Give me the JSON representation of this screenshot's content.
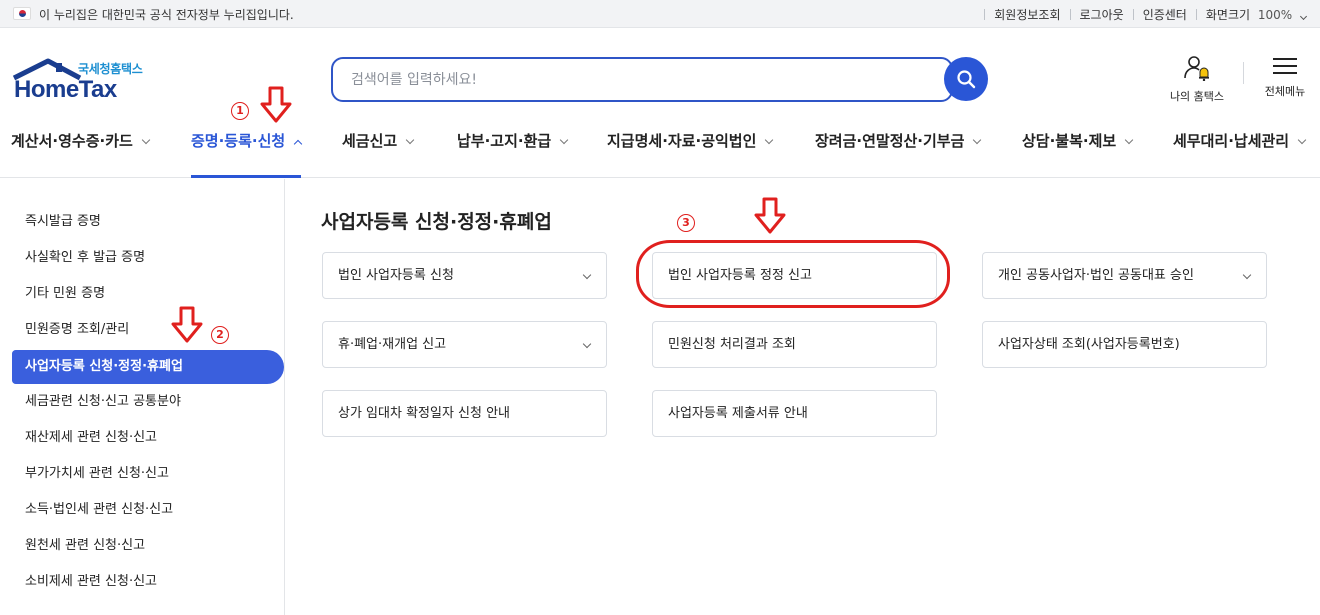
{
  "topbar": {
    "notice": "이 누리집은 대한민국 공식 전자정부 누리집입니다.",
    "links": [
      "회원정보조회",
      "로그아웃",
      "인증센터"
    ],
    "zoom_label": "화면크기",
    "zoom_value": "100%"
  },
  "logo": {
    "sub": "국세청홈택스",
    "main": "HomeTax"
  },
  "search": {
    "placeholder": "검색어를 입력하세요!"
  },
  "header": {
    "my_home": "나의 홈택스",
    "all_menu": "전체메뉴"
  },
  "nav": {
    "items": [
      "계산서·영수증·카드",
      "증명·등록·신청",
      "세금신고",
      "납부·고지·환급",
      "지급명세·자료·공익법인",
      "장려금·연말정산·기부금",
      "상담·불복·제보",
      "세무대리·납세관리"
    ],
    "active_index": 1
  },
  "sidebar": {
    "items": [
      "즉시발급 증명",
      "사실확인 후 발급 증명",
      "기타 민원 증명",
      "민원증명 조회/관리",
      "사업자등록 신청·정정·휴폐업",
      "세금관련 신청·신고 공통분야",
      "재산제세 관련 신청·신고",
      "부가가치세 관련 신청·신고",
      "소득·법인세 관련 신청·신고",
      "원천세 관련 신청·신고",
      "소비제세 관련 신청·신고"
    ],
    "active_index": 4
  },
  "main": {
    "title": "사업자등록 신청·정정·휴폐업",
    "cards": [
      {
        "label": "법인 사업자등록 신청",
        "expandable": true
      },
      {
        "label": "법인 사업자등록 정정 신고",
        "expandable": false
      },
      {
        "label": "개인 공동사업자·법인 공동대표 승인",
        "expandable": true
      },
      {
        "label": "휴·폐업·재개업 신고",
        "expandable": true
      },
      {
        "label": "민원신청 처리결과 조회",
        "expandable": false
      },
      {
        "label": "사업자상태 조회(사업자등록번호)",
        "expandable": false
      },
      {
        "label": "상가 임대차 확정일자 신청 안내",
        "expandable": false
      },
      {
        "label": "사업자등록 제출서류 안내",
        "expandable": false
      }
    ]
  },
  "annotations": {
    "step1": "1",
    "step2": "2",
    "step3": "3"
  },
  "colors": {
    "accent": "#2a56d6",
    "active_sidebar": "#3a5fdd",
    "annotation": "#e0201e"
  }
}
